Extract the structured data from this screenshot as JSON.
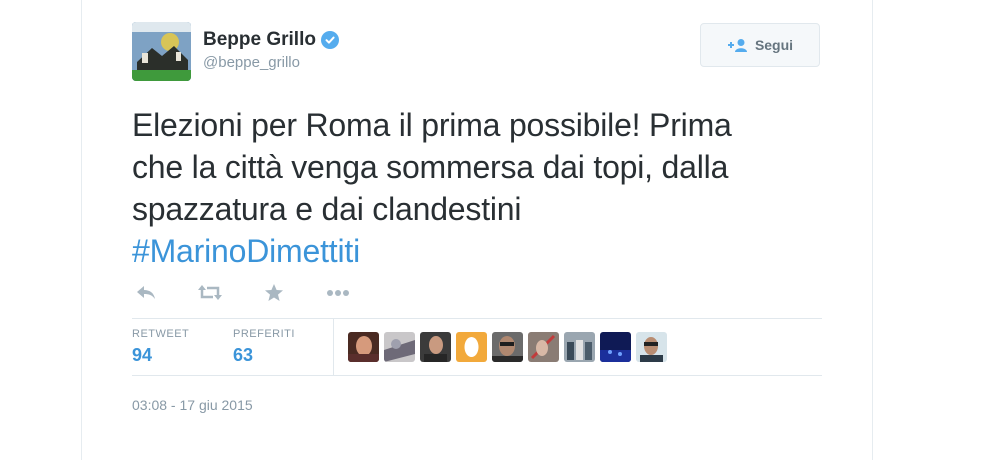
{
  "author": {
    "name": "Beppe Grillo",
    "handle": "@beppe_grillo",
    "verified": true
  },
  "follow_button": {
    "icon": "add-user-icon",
    "label": "Segui"
  },
  "tweet": {
    "text_lines": [
      "Elezioni per Roma il prima possibile! Prima",
      "che la città venga sommersa dai topi, dalla",
      "spazzatura e dai clandestini"
    ],
    "hashtag": "#MarinoDimettiti"
  },
  "actions": [
    "reply-icon",
    "retweet-icon",
    "favorite-icon",
    "more-icon"
  ],
  "stats": {
    "retweets": {
      "label": "RETWEET",
      "value": "94"
    },
    "favorites": {
      "label": "PREFERITI",
      "value": "63"
    }
  },
  "favoriters_count_shown": 9,
  "timestamp": "03:08 - 17 giu 2015",
  "colors": {
    "link": "#3b94d9",
    "verified": "#55acee",
    "muted": "#8899a6",
    "icon": "#aab8c2",
    "text": "#292f33"
  }
}
